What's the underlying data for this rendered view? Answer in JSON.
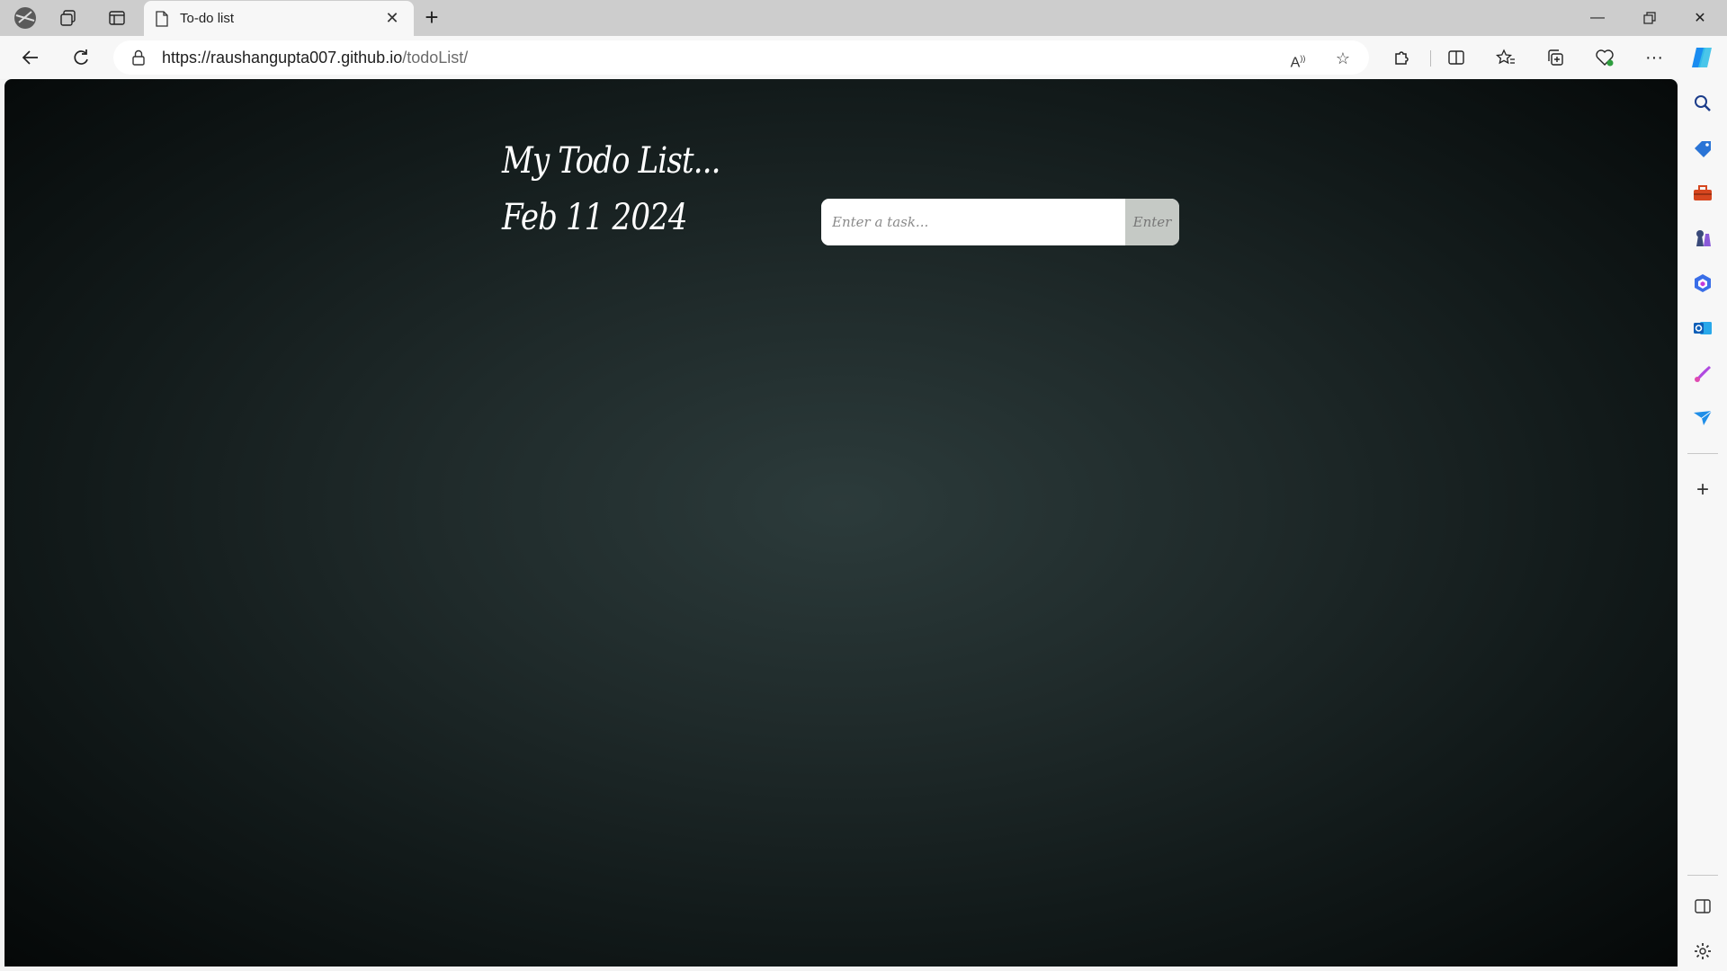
{
  "browser": {
    "tab_title": "To-do list",
    "url_host": "https://raushangupta007.github.io",
    "url_path": "/todoList/"
  },
  "page": {
    "title": "My Todo List...",
    "date": "Feb 11 2024",
    "task_placeholder": "Enter a task...",
    "enter_label": "Enter"
  },
  "sidebar": {
    "icons": [
      "search-icon",
      "shopping-tag-icon",
      "toolbox-icon",
      "games-icon",
      "microsoft-365-icon",
      "outlook-icon",
      "designer-icon",
      "send-icon",
      "add-icon",
      "sidebar-toggle-icon",
      "settings-icon"
    ]
  }
}
